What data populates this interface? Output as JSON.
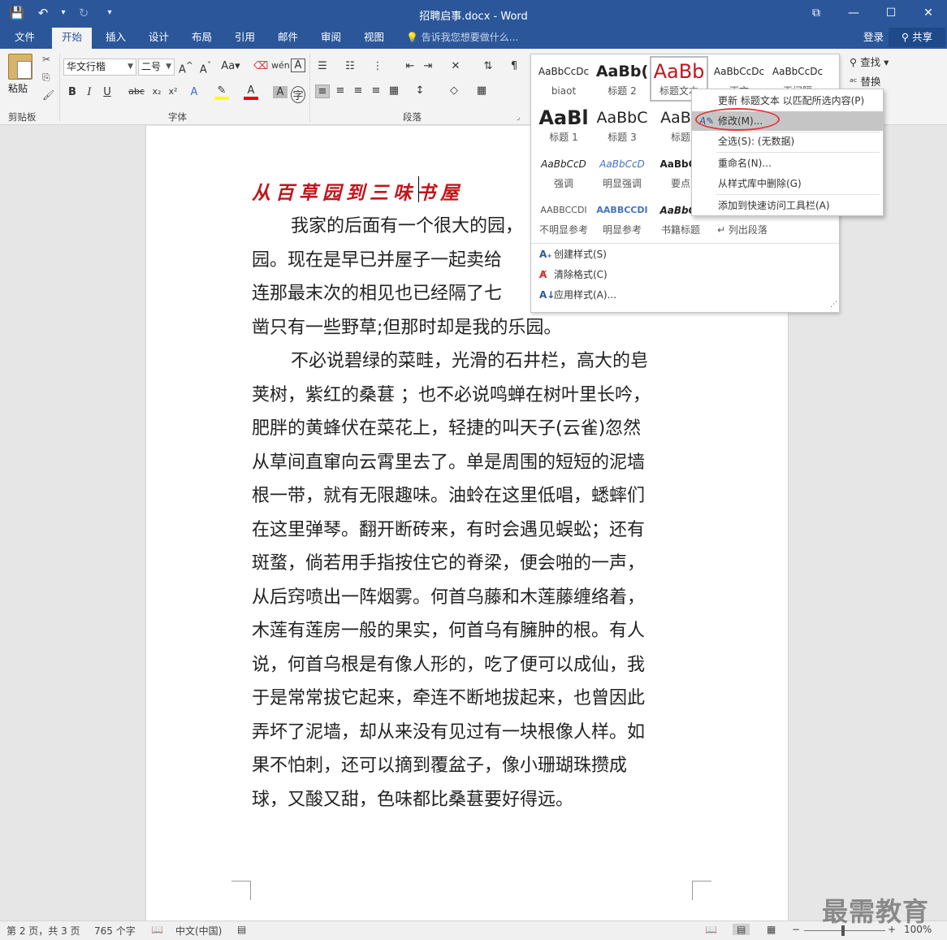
{
  "window": {
    "title": "招聘启事.docx - Word",
    "buttons": {
      "ribbon_display": "⧉",
      "minimize": "—",
      "maximize": "☐",
      "close": "✕"
    }
  },
  "qat": {
    "save": "💾",
    "undo": "↶",
    "undo_dd": "▾",
    "redo": "↻",
    "customize": "▾"
  },
  "tabs": [
    "文件",
    "开始",
    "插入",
    "设计",
    "布局",
    "引用",
    "邮件",
    "审阅",
    "视图"
  ],
  "active_tab": "开始",
  "tell_me": "告诉我您想要做什么...",
  "account": {
    "login": "登录",
    "share": "共享"
  },
  "ribbon": {
    "clipboard": {
      "label": "剪贴板",
      "paste": "粘贴"
    },
    "font": {
      "label": "字体",
      "family": "华文行楷",
      "size": "二号"
    },
    "paragraph": {
      "label": "段落"
    },
    "editing": {
      "find": "查找",
      "replace": "替换"
    }
  },
  "styles_gallery": {
    "rows": [
      [
        {
          "preview": "AaBbCcDc",
          "name": "biaot"
        },
        {
          "preview": "AaBb(",
          "name": "标题 2"
        },
        {
          "preview": "AaBb",
          "name": "标题文本"
        },
        {
          "preview": "AaBbCcDc",
          "name": "正文"
        },
        {
          "preview": "AaBbCcDc",
          "name": "无间隔"
        }
      ],
      [
        {
          "preview": "AaBl",
          "name": "标题 1"
        },
        {
          "preview": "AaBbC",
          "name": "标题 3"
        },
        {
          "preview": "AaBb",
          "name": "标题"
        }
      ],
      [
        {
          "preview": "AaBbCcD",
          "name": "强调"
        },
        {
          "preview": "AaBbCcD",
          "name": "明显强调"
        },
        {
          "preview": "AaBbCc",
          "name": "要点"
        }
      ],
      [
        {
          "preview": "AABBCCDI",
          "name": "不明显参考"
        },
        {
          "preview": "AABBCCDI",
          "name": "明显参考"
        },
        {
          "preview": "AaBbCc",
          "name": "书籍标题"
        },
        {
          "preview": "",
          "name": "↵ 列出段落"
        }
      ]
    ],
    "menu": [
      "创建样式(S)",
      "清除格式(C)",
      "应用样式(A)..."
    ]
  },
  "context_menu": {
    "items": [
      "更新 标题文本 以匹配所选内容(P)",
      "修改(M)...",
      "全选(S): (无数据)",
      "重命名(N)...",
      "从样式库中删除(G)",
      "添加到快速访问工具栏(A)"
    ],
    "highlighted": "修改(M)..."
  },
  "document": {
    "title": "从百草园到三味书屋",
    "lines": [
      "我家的后面有一个很大的园，",
      "园。现在是早已并屋子一起卖给",
      "连那最末次的相见也已经隔了七",
      "凿只有一些野草;但那时却是我的乐园。",
      "不必说碧绿的菜畦，光滑的石井栏，高大的皂",
      "荚树，紫红的桑葚 ；也不必说鸣蝉在树叶里长吟，",
      "肥胖的黄蜂伏在菜花上，轻捷的叫天子(云雀)忽然",
      "从草间直窜向云霄里去了。单是周围的短短的泥墙",
      "根一带，就有无限趣味。油蛉在这里低唱，蟋蟀们",
      "在这里弹琴。翻开断砖来，有时会遇见蜈蚣；还有",
      "斑蝥，倘若用手指按住它的脊梁，便会啪的一声，",
      "从后窍喷出一阵烟雾。何首乌藤和木莲藤缠络着，",
      "木莲有莲房一般的果实，何首乌有臃肿的根。有人",
      "说，何首乌根是有像人形的，吃了便可以成仙，我",
      "于是常常拔它起来，牵连不断地拔起来，也曾因此",
      "弄坏了泥墙，却从来没有见过有一块根像人样。如",
      "果不怕刺，还可以摘到覆盆子，像小珊瑚珠攒成",
      "球，又酸又甜，色味都比桑葚要好得远。"
    ]
  },
  "status": {
    "page": "第 2 页，共 3 页",
    "words": "765 个字",
    "lang": "中文(中国)",
    "zoom": "100%"
  },
  "watermark": "最需教育"
}
